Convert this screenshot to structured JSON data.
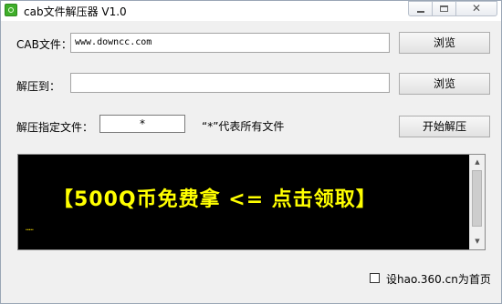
{
  "window": {
    "title": "cab文件解压器 V1.0",
    "icon": "recycle-icon",
    "controls": {
      "minimize": "minimize-icon",
      "maximize": "maximize-icon",
      "close": "✕"
    }
  },
  "cab_file": {
    "label": "CAB文件：",
    "value": "www.downcc.com",
    "browse_label": "浏览"
  },
  "extract_to": {
    "label": "解压到：",
    "value": "",
    "browse_label": "浏览"
  },
  "filter": {
    "label": "解压指定文件：",
    "value": "*",
    "hint": "“*”代表所有文件",
    "start_label": "开始解压"
  },
  "console": {
    "promo_text": "【500Q币免费拿 <= 点击领取】",
    "promo_color": "#ffff00",
    "cursor_text": "……",
    "background": "#000000"
  },
  "homepage_option": {
    "label": "设hao.360.cn为首页",
    "checked": false
  }
}
